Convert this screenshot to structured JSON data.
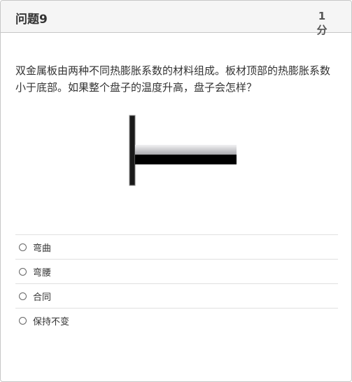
{
  "question": {
    "title": "问题9",
    "points_number": "1",
    "points_unit": "分",
    "text": "双金属板由两种不同热膨胀系数的材料组成。板材顶部的热膨胀系数小于底部。如果整个盘子的温度升高，盘子会怎样？"
  },
  "answers": [
    {
      "label": "弯曲"
    },
    {
      "label": "弯腰"
    },
    {
      "label": "合同"
    },
    {
      "label": "保持不变"
    }
  ]
}
